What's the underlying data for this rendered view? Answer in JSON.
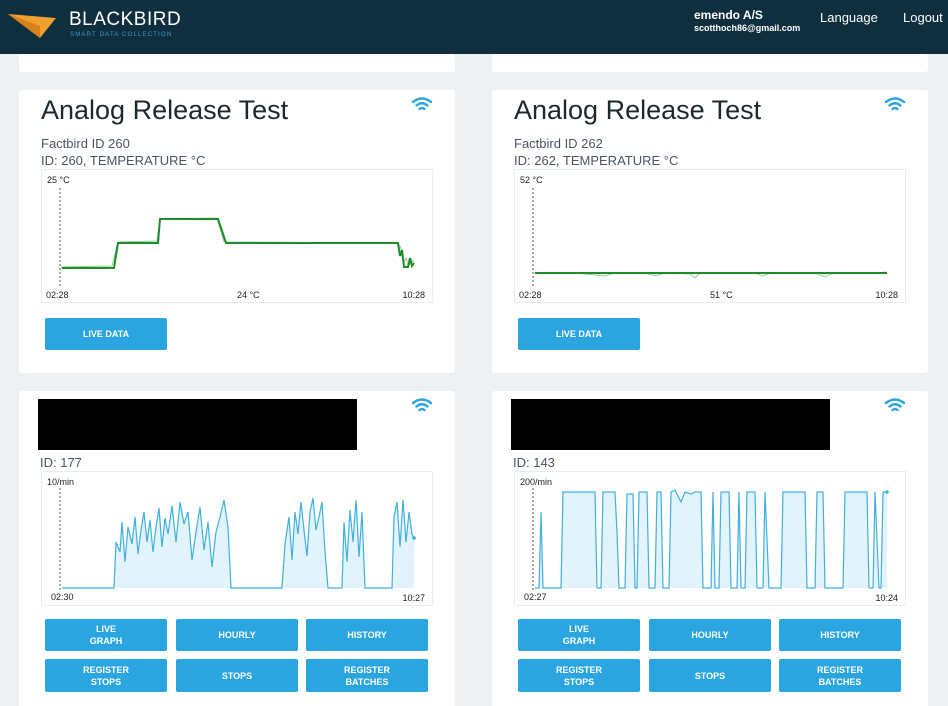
{
  "header": {
    "brand": "BLACKBIRD",
    "tagline": "SMART DATA COLLECTION",
    "user_name": "emendo A/S",
    "user_email": "scotthoch86@gmail.com",
    "language_label": "Language",
    "logout_label": "Logout"
  },
  "cards": [
    {
      "title": "Analog Release Test",
      "subtitle": "Factbird ID 260",
      "id_line": "ID: 260, TEMPERATURE °C",
      "chart": {
        "max_label": "25 °C",
        "mid_label": "24 °C",
        "start_label": "02:28",
        "end_label": "10:28"
      },
      "live_label": "LIVE DATA"
    },
    {
      "title": "Analog Release Test",
      "subtitle": "Factbird ID 262",
      "id_line": "ID: 262, TEMPERATURE °C",
      "chart": {
        "max_label": "52 °C",
        "mid_label": "51 °C",
        "start_label": "02:28",
        "end_label": "10:28"
      },
      "live_label": "LIVE DATA"
    },
    {
      "id_line": "ID: 177",
      "chart": {
        "max_label": "10/min",
        "start_label": "02:30",
        "end_label": "10:27"
      },
      "buttons": {
        "live_graph": "LIVE\nGRAPH",
        "hourly": "HOURLY",
        "history": "HISTORY",
        "register_stops": "REGISTER\nSTOPS",
        "stops": "STOPS",
        "register_batches": "REGISTER\nBATCHES"
      }
    },
    {
      "id_line": "ID: 143",
      "chart": {
        "max_label": "200/min",
        "start_label": "02:27",
        "end_label": "10:24"
      },
      "buttons": {
        "live_graph": "LIVE\nGRAPH",
        "hourly": "HOURLY",
        "history": "HISTORY",
        "register_stops": "REGISTER\nSTOPS",
        "stops": "STOPS",
        "register_batches": "REGISTER\nBATCHES"
      }
    }
  ],
  "colors": {
    "topbar": "#0f2e3e",
    "accent": "#2aa5e0",
    "logo_orange": "#f0a030",
    "temp_line": "#1e8c2a",
    "rate_line": "#3fb0e0"
  },
  "icons": {
    "logo": "blackbird-logo",
    "signal": "wifi-icon"
  }
}
